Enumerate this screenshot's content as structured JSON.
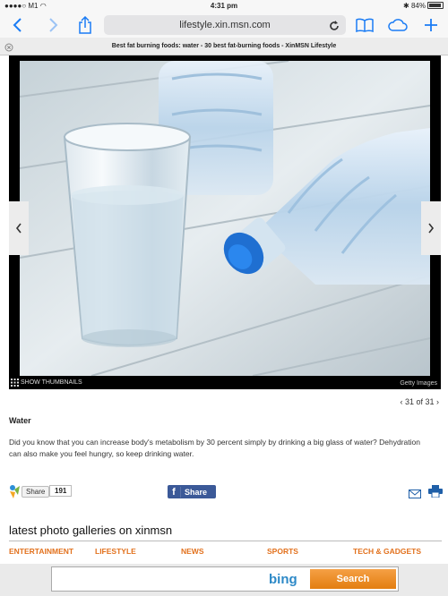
{
  "status": {
    "carrier": "M1",
    "time": "4:31 pm",
    "battery": "84%"
  },
  "browser": {
    "url": "lifestyle.xin.msn.com",
    "tab_title": "Best fat burning foods: water - 30 best fat-burning foods - XinMSN Lifestyle"
  },
  "gallery": {
    "show_thumbnails": "SHOW THUMBNAILS",
    "credit": "Getty Images",
    "pager": "31 of 31"
  },
  "article": {
    "title": "Water",
    "description": "Did you know that you can increase body's metabolism by 30 percent simply by drinking a big glass of water? Dehydration can also make you feel hungry, so keep drinking water."
  },
  "share": {
    "share_label": "Share",
    "count": "191",
    "fb_label": "Share"
  },
  "galleries": {
    "heading": "latest photo galleries on xinmsn",
    "tabs": [
      "ENTERTAINMENT",
      "LIFESTYLE",
      "NEWS",
      "SPORTS",
      "TECH & GADGETS"
    ]
  },
  "search": {
    "logo": "bing",
    "button": "Search"
  },
  "colors": {
    "accent": "#1a7cf5",
    "category": "#e2711d",
    "facebook": "#3b5998",
    "bing": "#2d89c7"
  }
}
